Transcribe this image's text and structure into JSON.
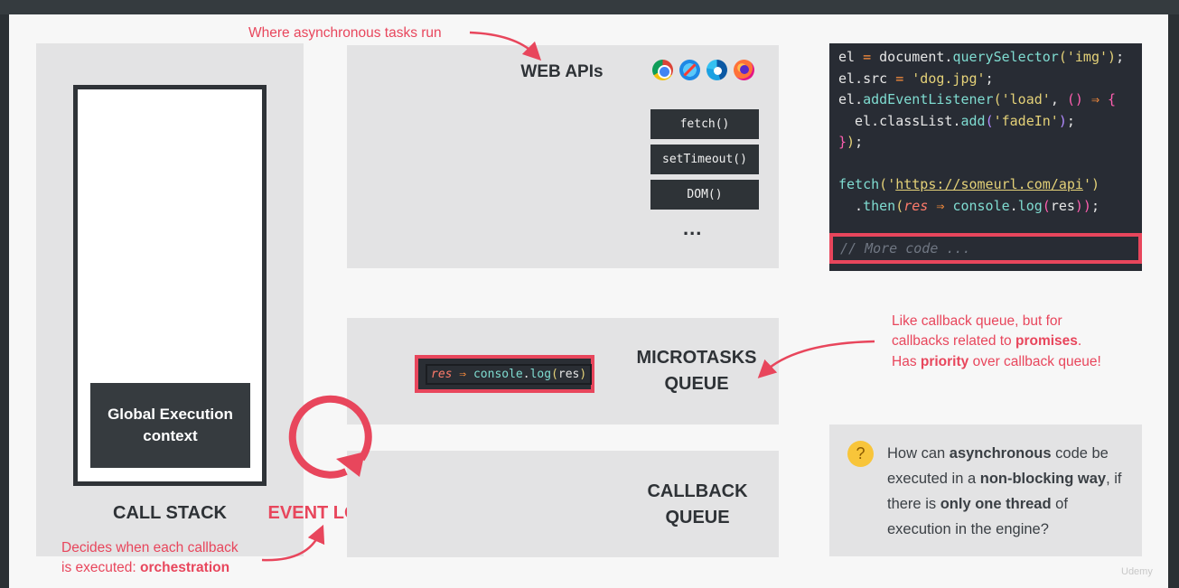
{
  "annotations": {
    "where_tasks_run": "Where asynchronous tasks run",
    "decides_line1": "Decides when each callback",
    "decides_line2_prefix": "is executed: ",
    "decides_line2_bold": "orchestration",
    "callback_like_line1": "Like callback queue, but for",
    "callback_like_line2_prefix": "callbacks related to ",
    "callback_like_line2_bold": "promises",
    "callback_like_line2_suffix": ".",
    "callback_like_line3_prefix": "Has ",
    "callback_like_line3_bold": "priority",
    "callback_like_line3_suffix": " over callback queue!"
  },
  "call_stack": {
    "label": "CALL STACK",
    "global_execution_context": "Global Execution context"
  },
  "event_loop": {
    "label": "EVENT LOOP"
  },
  "web_apis": {
    "title": "WEB APIs",
    "browser_icons": [
      "chrome-icon",
      "safari-icon",
      "edge-icon",
      "firefox-icon"
    ],
    "apis": [
      "fetch()",
      "setTimeout()",
      "DOM()"
    ],
    "more": "..."
  },
  "code": {
    "l1a": "el",
    "l1b": " = ",
    "l1c": "document",
    "l1d": ".",
    "l1e": "querySelector",
    "l1f": "(",
    "l1g": "'img'",
    "l1h": ")",
    "l1i": ";",
    "l2a": "el",
    "l2b": ".",
    "l2c": "src",
    "l2d": " = ",
    "l2e": "'dog.jpg'",
    "l2f": ";",
    "l3a": "el",
    "l3b": ".",
    "l3c": "addEventListener",
    "l3d": "(",
    "l3e": "'load'",
    "l3f": ", ",
    "l3g": "()",
    "l3h": " ⇒ ",
    "l3i": "{",
    "l4a": "  el",
    "l4b": ".",
    "l4c": "classList",
    "l4d": ".",
    "l4e": "add",
    "l4f": "(",
    "l4g": "'fadeIn'",
    "l4h": ")",
    "l4i": ";",
    "l5a": "}",
    "l5b": ")",
    "l5c": ";",
    "l7a": "fetch",
    "l7b": "(",
    "l7c": "'",
    "l7d": "https://someurl.com/api",
    "l7e": "'",
    "l7f": ")",
    "l8a": "  .",
    "l8b": "then",
    "l8c": "(",
    "l8d": "res",
    "l8e": " ⇒ ",
    "l8f": "console",
    "l8g": ".",
    "l8h": "log",
    "l8i": "(",
    "l8j": "res",
    "l8k": "))",
    "l8l": ";",
    "more_code": "// More code ..."
  },
  "microtasks_queue": {
    "title_line1": "MICROTASKS",
    "title_line2": "QUEUE",
    "item_param": "res",
    "item_arrow": " ⇒ ",
    "item_console": "console",
    "item_dot": ".",
    "item_log": "log",
    "item_open": "(",
    "item_res": "res",
    "item_close": ")"
  },
  "callback_queue": {
    "title_line1": "CALLBACK",
    "title_line2": "QUEUE"
  },
  "question": {
    "emoji_icon": "thinking-face-icon",
    "p1": "How can ",
    "b1": "asynchronous",
    "p2": " code be executed in a ",
    "b2": "non-blocking way",
    "p3": ", if there is ",
    "b3": "only one thread",
    "p4": " of execution in the engine?"
  },
  "watermark": "Udemy",
  "colors": {
    "accent_red": "#e8465c",
    "panel_gray": "#e3e3e4",
    "dark": "#2e3337",
    "code_bg": "#282c34"
  }
}
